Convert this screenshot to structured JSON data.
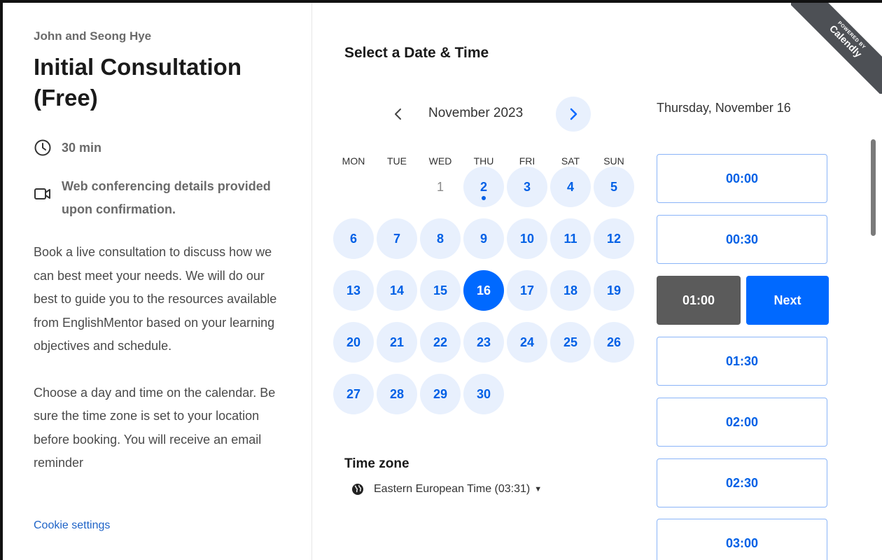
{
  "event": {
    "host": "John and Seong Hye",
    "title": "Initial Consultation (Free)",
    "duration": "30 min",
    "conferencing": "Web conferencing details provided upon confirmation.",
    "description": [
      "Book a live consultation to discuss how we can best meet your needs. We will do our best to guide you to the resources available from EnglishMentor based on your learning objectives and schedule.",
      "Choose a day and time on the calendar. Be sure the time zone is set to your location before booking. You will receive an email reminder"
    ],
    "cookie_settings": "Cookie settings"
  },
  "calendar": {
    "title": "Select a Date & Time",
    "month": "November 2023",
    "weekdays": [
      "MON",
      "TUE",
      "WED",
      "THU",
      "FRI",
      "SAT",
      "SUN"
    ],
    "days": [
      {
        "d": "1",
        "state": "unavailable"
      },
      {
        "d": "2",
        "state": "available",
        "today": true
      },
      {
        "d": "3",
        "state": "available"
      },
      {
        "d": "4",
        "state": "available"
      },
      {
        "d": "5",
        "state": "available"
      },
      {
        "d": "6",
        "state": "available"
      },
      {
        "d": "7",
        "state": "available"
      },
      {
        "d": "8",
        "state": "available"
      },
      {
        "d": "9",
        "state": "available"
      },
      {
        "d": "10",
        "state": "available"
      },
      {
        "d": "11",
        "state": "available"
      },
      {
        "d": "12",
        "state": "available"
      },
      {
        "d": "13",
        "state": "available"
      },
      {
        "d": "14",
        "state": "available"
      },
      {
        "d": "15",
        "state": "available"
      },
      {
        "d": "16",
        "state": "selected"
      },
      {
        "d": "17",
        "state": "available"
      },
      {
        "d": "18",
        "state": "available"
      },
      {
        "d": "19",
        "state": "available"
      },
      {
        "d": "20",
        "state": "available"
      },
      {
        "d": "21",
        "state": "available"
      },
      {
        "d": "22",
        "state": "available"
      },
      {
        "d": "23",
        "state": "available"
      },
      {
        "d": "24",
        "state": "available"
      },
      {
        "d": "25",
        "state": "available"
      },
      {
        "d": "26",
        "state": "available"
      },
      {
        "d": "27",
        "state": "available"
      },
      {
        "d": "28",
        "state": "available"
      },
      {
        "d": "29",
        "state": "available"
      },
      {
        "d": "30",
        "state": "available"
      }
    ],
    "timezone_label": "Time zone",
    "timezone_value": "Eastern European Time (03:31)"
  },
  "times": {
    "date_heading": "Thursday, November 16",
    "slots": [
      "00:00",
      "00:30",
      "01:00",
      "01:30",
      "02:00",
      "02:30",
      "03:00"
    ],
    "selected_slot": "01:00",
    "next_label": "Next"
  },
  "badge": {
    "powered_by": "POWERED BY",
    "brand": "Calendly"
  },
  "colors": {
    "accent": "#0069ff",
    "available_bg": "#e8f0fd",
    "selected_slot_bg": "#5b5b5b",
    "ribbon_bg": "#4d5055",
    "link": "#1e63c7"
  },
  "icons": {
    "duration": "clock-icon",
    "conferencing": "video-camera-icon",
    "timezone": "globe-icon",
    "prev_month": "chevron-left-icon",
    "next_month": "chevron-right-icon",
    "timezone_dropdown": "caret-down-icon"
  }
}
